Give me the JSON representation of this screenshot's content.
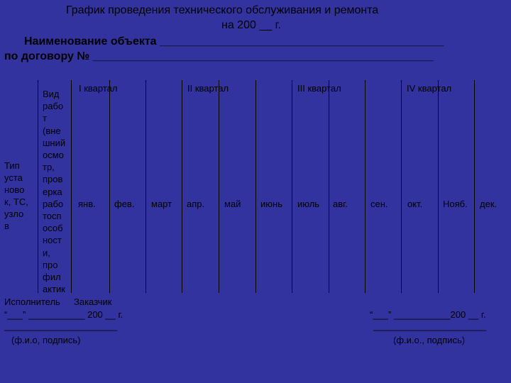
{
  "header": {
    "title_line1": "График проведения технического обслуживания и ремонта",
    "title_line2": "на 200 __ г.",
    "object_line": "Наименование объекта _____________________________________________",
    "contract_line": "по договору № ______________________________________________________"
  },
  "table": {
    "col0_text": "Тип\nуста\nново\nк, ТС,\nузло\nв",
    "col1_text": "Вид\nрабо\nт\n(вне\nшний\nосмо\nтр,\nпров\nерка\nрабо\nтосп\nособ\nност\nи,\nпро\nфил\nактик\nа",
    "quarters": [
      "I квартал",
      "II квартал",
      "III квартал",
      "IV квартал"
    ],
    "months": [
      "янв.",
      "фев.",
      "март",
      "апр.",
      "май",
      "июнь",
      "июль",
      "авг.",
      "сен.",
      "окт.",
      "Нояб.",
      "дек."
    ]
  },
  "signatures": {
    "left_role": "Исполнитель",
    "right_role": "Заказчик",
    "left_date": "“___” ___________ 200 __ г.",
    "right_date": "“___” ___________200 __ г.",
    "left_line": "______________________",
    "right_line": "______________________",
    "left_caption": "(ф.и.о, подпись)",
    "right_caption": "(ф.и.о., подпись)"
  }
}
